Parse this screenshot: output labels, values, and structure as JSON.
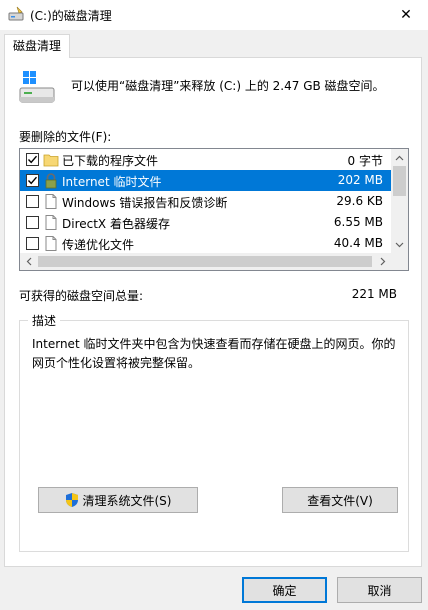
{
  "window": {
    "title": "(C:)的磁盘清理",
    "close_glyph": "✕",
    "icon": "disk-cleanup-icon"
  },
  "tab": {
    "label": "磁盘清理"
  },
  "summary": {
    "text": "可以使用“磁盘清理”来释放 (C:) 上的 2.47 GB 磁盘空间。",
    "icon": "drive-icon"
  },
  "files_label": "要删除的文件(F):",
  "files": [
    {
      "checked": true,
      "icon": "folder-icon",
      "name": "已下载的程序文件",
      "size": "0 字节",
      "selected": false
    },
    {
      "checked": true,
      "icon": "lock-icon",
      "name": "Internet 临时文件",
      "size": "202 MB",
      "selected": true
    },
    {
      "checked": false,
      "icon": "document-icon",
      "name": "Windows 错误报告和反馈诊断",
      "size": "29.6 KB",
      "selected": false
    },
    {
      "checked": false,
      "icon": "document-icon",
      "name": "DirectX 着色器缓存",
      "size": "6.55 MB",
      "selected": false
    },
    {
      "checked": false,
      "icon": "document-icon",
      "name": "传递优化文件",
      "size": "40.4 MB",
      "selected": false
    }
  ],
  "gain": {
    "label": "可获得的磁盘空间总量:",
    "value": "221 MB"
  },
  "description": {
    "legend": "描述",
    "text": "Internet 临时文件夹中包含为快速查看而存储在硬盘上的网页。你的网页个性化设置将被完整保留。"
  },
  "buttons": {
    "cleanup_system": "清理系统文件(S)",
    "view_files": "查看文件(V)",
    "ok": "确定",
    "cancel": "取消"
  },
  "colors": {
    "selection": "#0078d7",
    "window_bg": "#f0f0f0",
    "panel_bg": "#ffffff"
  }
}
